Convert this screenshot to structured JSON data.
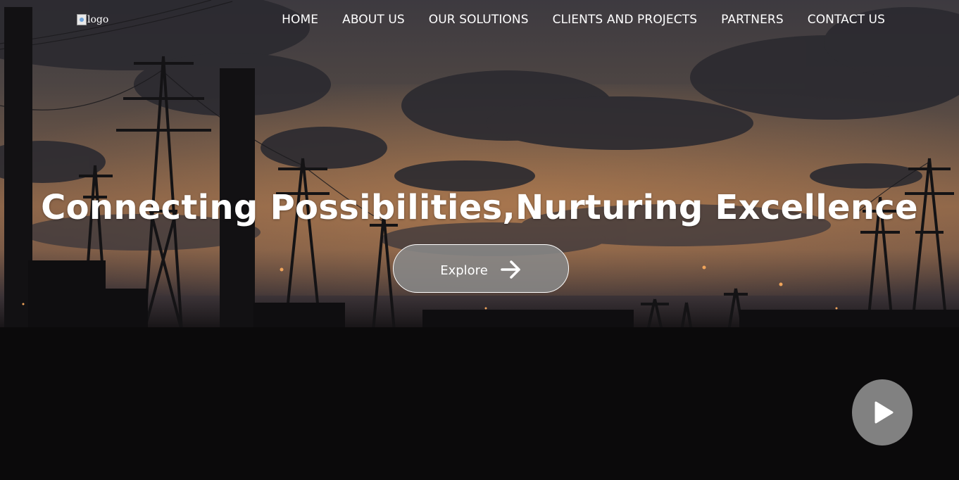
{
  "header": {
    "logo_alt": "logo",
    "nav": [
      {
        "label": "HOME"
      },
      {
        "label": "ABOUT US"
      },
      {
        "label": "OUR SOLUTIONS"
      },
      {
        "label": "CLIENTS AND PROJECTS"
      },
      {
        "label": "PARTNERS"
      },
      {
        "label": "CONTACT US"
      }
    ]
  },
  "hero": {
    "headline": "Connecting Possibilities,Nurturing Excellence",
    "explore_label": "Explore",
    "explore_icon": "arrow-right-icon",
    "play_icon": "play-icon"
  },
  "colors": {
    "text": "#ffffff",
    "button_fill": "#878787",
    "play_fill": "#969696",
    "ground": "#0b0a0b"
  }
}
